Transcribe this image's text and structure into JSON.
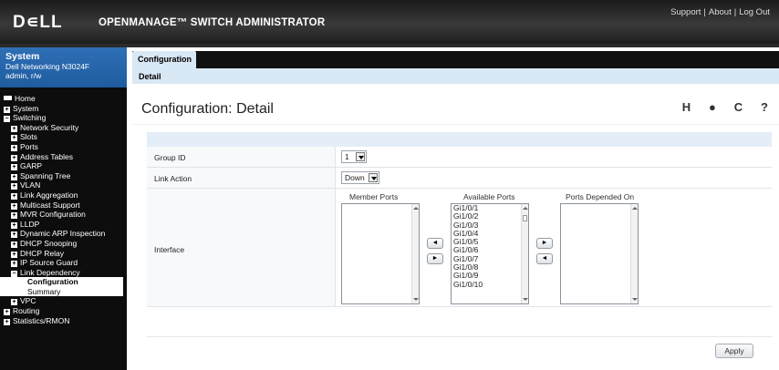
{
  "header": {
    "logo": "D∊LL",
    "app_title": "OPENMANAGE™ SWITCH ADMINISTRATOR",
    "links": [
      "Support",
      "About",
      "Log Out"
    ]
  },
  "system": {
    "title": "System",
    "model": "Dell Networking N3024F",
    "user": "admin, r/w"
  },
  "sidebar": {
    "items": [
      {
        "label": "Home",
        "level": 0,
        "icon": "home"
      },
      {
        "label": "System",
        "level": 0,
        "icon": "plus"
      },
      {
        "label": "Switching",
        "level": 0,
        "icon": "minus"
      },
      {
        "label": "Network Security",
        "level": 1,
        "icon": "plus"
      },
      {
        "label": "Slots",
        "level": 1,
        "icon": "plus"
      },
      {
        "label": "Ports",
        "level": 1,
        "icon": "plus"
      },
      {
        "label": "Address Tables",
        "level": 1,
        "icon": "plus"
      },
      {
        "label": "GARP",
        "level": 1,
        "icon": "plus"
      },
      {
        "label": "Spanning Tree",
        "level": 1,
        "icon": "plus"
      },
      {
        "label": "VLAN",
        "level": 1,
        "icon": "plus"
      },
      {
        "label": "Link Aggregation",
        "level": 1,
        "icon": "plus"
      },
      {
        "label": "Multicast Support",
        "level": 1,
        "icon": "plus"
      },
      {
        "label": "MVR Configuration",
        "level": 1,
        "icon": "plus"
      },
      {
        "label": "LLDP",
        "level": 1,
        "icon": "plus"
      },
      {
        "label": "Dynamic ARP Inspection",
        "level": 1,
        "icon": "plus"
      },
      {
        "label": "DHCP Snooping",
        "level": 1,
        "icon": "plus"
      },
      {
        "label": "DHCP Relay",
        "level": 1,
        "icon": "plus"
      },
      {
        "label": "IP Source Guard",
        "level": 1,
        "icon": "plus"
      },
      {
        "label": "Link Dependency",
        "level": 1,
        "icon": "minus"
      },
      {
        "label": "Configuration",
        "level": 2,
        "icon": "none",
        "selected": true
      },
      {
        "label": "Summary",
        "level": 2,
        "icon": "none"
      },
      {
        "label": "VPC",
        "level": 1,
        "icon": "plus"
      },
      {
        "label": "Routing",
        "level": 0,
        "icon": "plus"
      },
      {
        "label": "Statistics/RMON",
        "level": 0,
        "icon": "plus"
      }
    ]
  },
  "tabs": {
    "active": "Configuration",
    "subtab": "Detail"
  },
  "page": {
    "title": "Configuration: Detail"
  },
  "toolbar": {
    "icons": [
      "save-icon",
      "print-icon",
      "refresh-icon",
      "help-icon"
    ],
    "glyphs": [
      "H",
      "●",
      "C",
      "?"
    ]
  },
  "form": {
    "group_id_label": "Group ID",
    "group_id_value": "1",
    "link_action_label": "Link Action",
    "link_action_value": "Down",
    "interface_label": "Interface",
    "member_ports_head": "Member Ports",
    "available_ports_head": "Available Ports",
    "ports_depended_head": "Ports Depended On",
    "available_ports": [
      "Gi1/0/1",
      "Gi1/0/2",
      "Gi1/0/3",
      "Gi1/0/4",
      "Gi1/0/5",
      "Gi1/0/6",
      "Gi1/0/7",
      "Gi1/0/8",
      "Gi1/0/9",
      "Gi1/0/10"
    ],
    "move_left": "◄",
    "move_right": "►"
  },
  "actions": {
    "apply": "Apply"
  }
}
